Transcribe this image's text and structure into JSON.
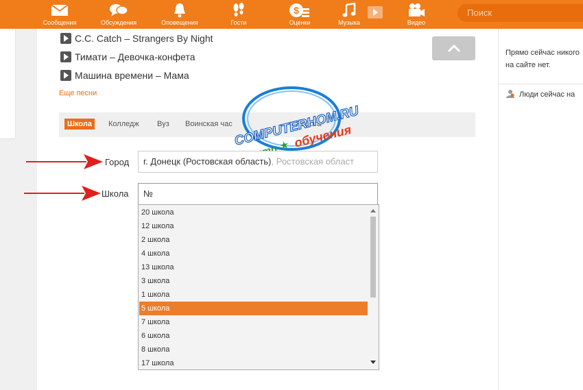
{
  "nav": {
    "items": [
      {
        "label": "Сообщения",
        "icon": "envelope-icon"
      },
      {
        "label": "Обсуждения",
        "icon": "chat-bubbles-icon"
      },
      {
        "label": "Оповещения",
        "icon": "bell-icon"
      },
      {
        "label": "Гости",
        "icon": "footprints-icon"
      },
      {
        "label": "Оценки",
        "icon": "money-rating-icon"
      },
      {
        "label": "Музыка",
        "icon": "music-note-icon"
      },
      {
        "label": "Видео",
        "icon": "video-camera-icon"
      }
    ],
    "search_placeholder": "Поиск"
  },
  "songs": [
    "C.C. Catch – Strangers By Night",
    "Тимати – Девочка-конфета",
    "Машина времени – Мама"
  ],
  "more_songs": "Еще песни",
  "tabs": [
    "Школа",
    "Колледж",
    "Вуз",
    "Воинская час",
    "ь",
    "Работа"
  ],
  "form": {
    "city_label": "Город",
    "city_value": "г. Донецк (Ростовская область)",
    "city_hint": ", Ростовская област",
    "school_label": "Школа",
    "school_value": "№"
  },
  "school_options": [
    "20 школа",
    "12 школа",
    "2 школа",
    "4 школа",
    "13 школа",
    "3 школа",
    "1 школа",
    "5 школа",
    "7 школа",
    "6 школа",
    "8 школа",
    "17 школа"
  ],
  "selected_option": "5 школа",
  "right": {
    "line1": "Прямо сейчас никого",
    "line2": "на сайте нет.",
    "people_now": "Люди сейчас на"
  },
  "watermark": {
    "brand": "COMPUTERHOM.RU",
    "left": "центр",
    "right": "обучения"
  },
  "colors": {
    "brand": "#f07c1a",
    "accent": "#eb6d18",
    "arrow": "#e02020"
  }
}
